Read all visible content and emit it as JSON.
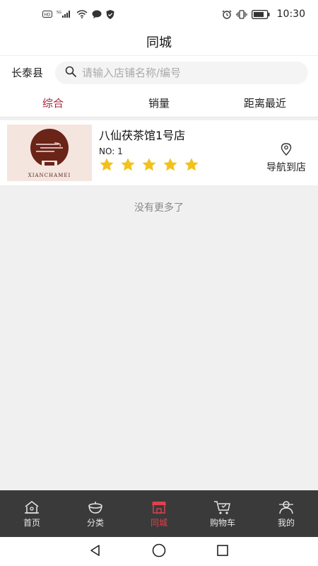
{
  "status_bar": {
    "left_icons": [
      "hd-icon",
      "signal-icon",
      "wifi-icon",
      "message-icon",
      "shield-icon"
    ],
    "hd_label": "HD",
    "network_label": "5G",
    "right_icons": [
      "alarm-icon",
      "vibrate-icon",
      "battery-icon"
    ],
    "time": "10:30"
  },
  "header": {
    "title": "同城"
  },
  "search": {
    "city": "长泰县",
    "placeholder": "请输入店铺名称/编号"
  },
  "tabs": [
    {
      "label": "综合",
      "active": true
    },
    {
      "label": "销量",
      "active": false
    },
    {
      "label": "距离最近",
      "active": false
    }
  ],
  "stores": [
    {
      "name": "八仙茯茶馆1号店",
      "number_label": "NO: 1",
      "rating": 5,
      "max_rating": 5,
      "logo_text": "XIANCHAMEI",
      "navigate_label": "导航到店"
    }
  ],
  "list_footer": "没有更多了",
  "bottom_nav": [
    {
      "label": "首页",
      "icon": "home-icon",
      "active": false
    },
    {
      "label": "分类",
      "icon": "category-icon",
      "active": false
    },
    {
      "label": "同城",
      "icon": "store-icon",
      "active": true
    },
    {
      "label": "购物车",
      "icon": "cart-icon",
      "active": false
    },
    {
      "label": "我的",
      "icon": "profile-icon",
      "active": false
    }
  ],
  "system_nav": [
    "back-icon",
    "home-circle-icon",
    "recents-icon"
  ],
  "colors": {
    "accent": "#a8263a",
    "star": "#f2c21b",
    "bottom_nav_bg": "#3a3a3a",
    "bottom_nav_active": "#e0414f"
  }
}
